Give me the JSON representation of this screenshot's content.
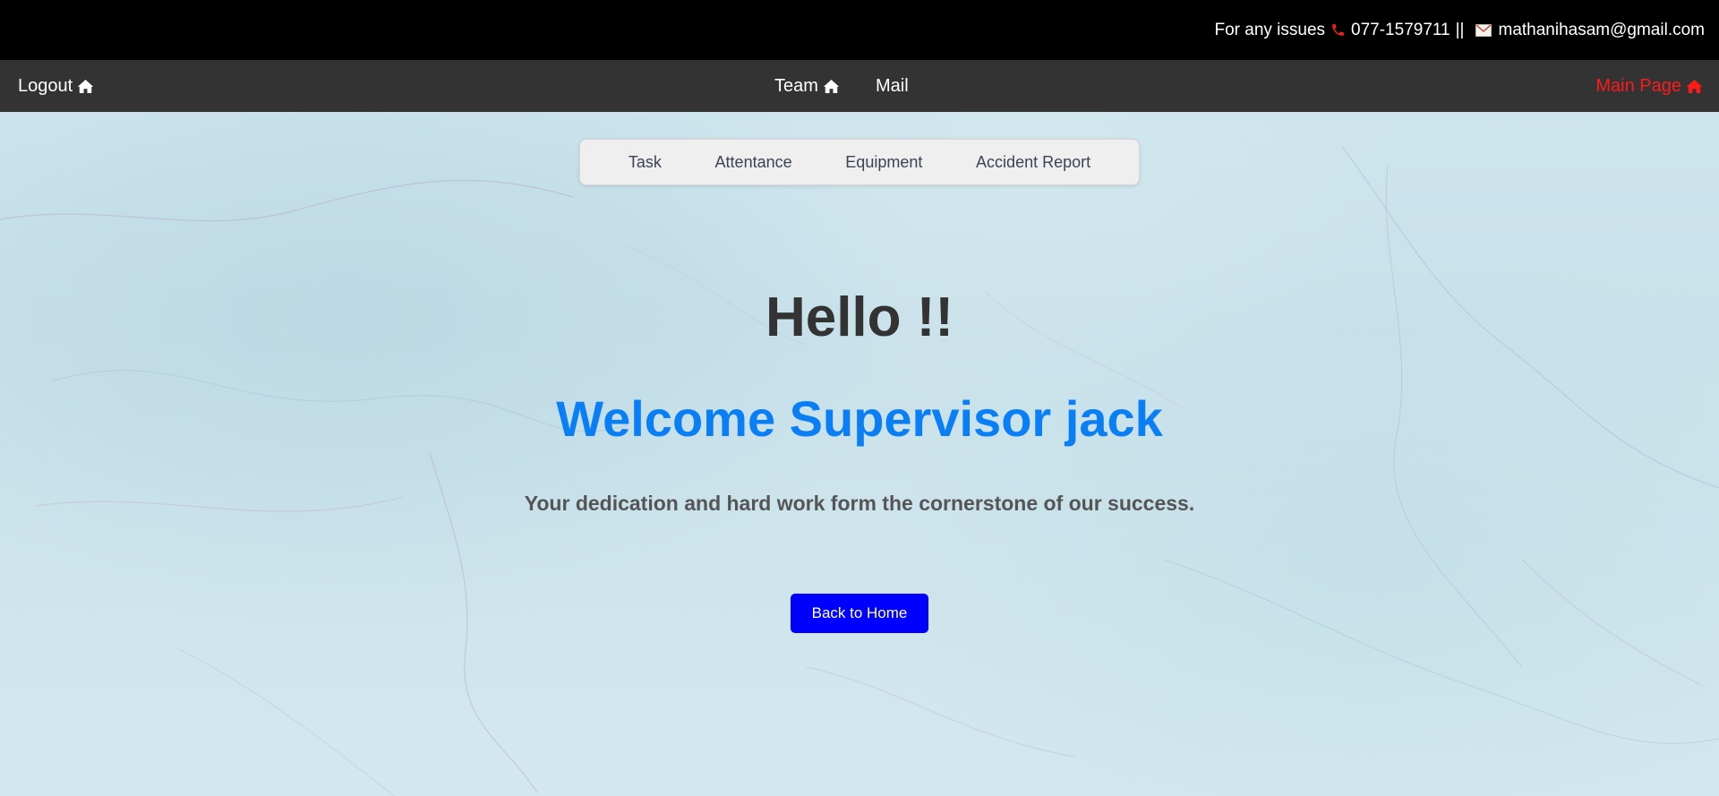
{
  "contact_bar": {
    "prefix": "For any issues",
    "phone": "077-1579711",
    "separator": "||",
    "email": "mathanihasam@gmail.com",
    "phone_icon_color": "#e8211c"
  },
  "nav": {
    "logout": "Logout",
    "team": "Team",
    "mail": "Mail",
    "main_page": "Main Page",
    "main_page_color": "#ff1a1a",
    "bar_color": "#333333"
  },
  "submenu": {
    "items": [
      "Task",
      "Attentance",
      "Equipment",
      "Accident Report"
    ]
  },
  "hero": {
    "greeting": "Hello !!",
    "welcome": "Welcome Supervisor jack",
    "welcome_color": "#0a7ff5",
    "tagline": "Your dedication and hard work form the cornerstone of our success."
  },
  "actions": {
    "back_home": "Back to Home",
    "button_color": "#0000ff"
  },
  "icons": {
    "phone": "phone-icon",
    "mail": "envelope-icon",
    "home": "home-icon"
  }
}
